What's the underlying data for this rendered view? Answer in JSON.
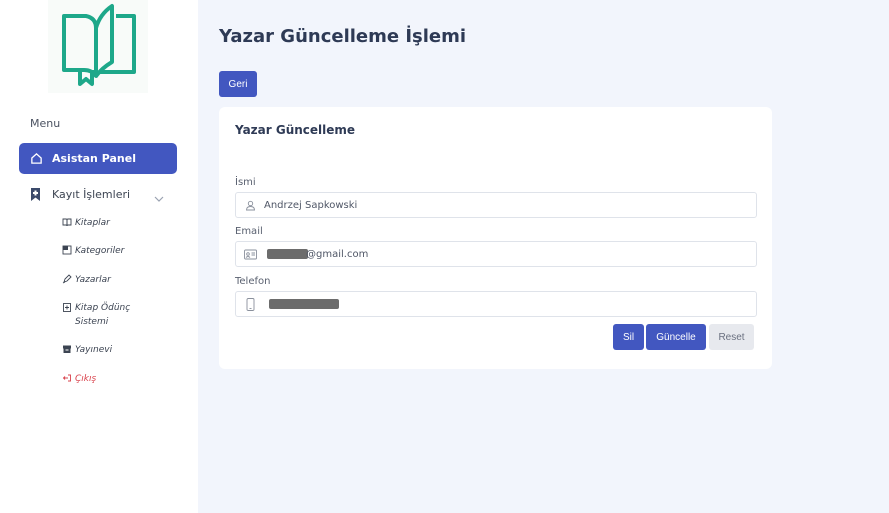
{
  "sidebar": {
    "menu_title": "Menu",
    "active_item": {
      "label": "Asistan Panel",
      "icon": "home-icon"
    },
    "group": {
      "label": "Kayıt İşlemleri",
      "icon": "bookmark-icon",
      "expanded": true
    },
    "sub_items": [
      {
        "label": "Kitaplar",
        "icon": "book-icon"
      },
      {
        "label": "Kategoriler",
        "icon": "category-icon"
      },
      {
        "label": "Yazarlar",
        "icon": "pen-icon"
      },
      {
        "label": "Kitap Ödünç Sistemi",
        "icon": "lend-icon"
      },
      {
        "label": "Yayınevi",
        "icon": "box-icon"
      },
      {
        "label": "Çıkış",
        "icon": "logout-icon"
      }
    ]
  },
  "main": {
    "page_title": "Yazar Güncelleme İşlemi",
    "back_button": "Geri",
    "card": {
      "title": "Yazar Güncelleme",
      "fields": [
        {
          "label": "İsmi",
          "value": "Andrzej Sapkowski",
          "icon": "user-icon"
        },
        {
          "label": "Email",
          "value": "@gmail.com",
          "icon": "id-card-icon",
          "redacted": true
        },
        {
          "label": "Telefon",
          "value": "",
          "icon": "phone-icon",
          "redacted": true
        }
      ],
      "buttons": {
        "delete": "Sil",
        "update": "Güncelle",
        "reset": "Reset"
      }
    }
  },
  "colors": {
    "primary": "#4257c0",
    "logo": "#1ea88a",
    "exit": "#d9434d",
    "background": "#f2f5fc"
  }
}
